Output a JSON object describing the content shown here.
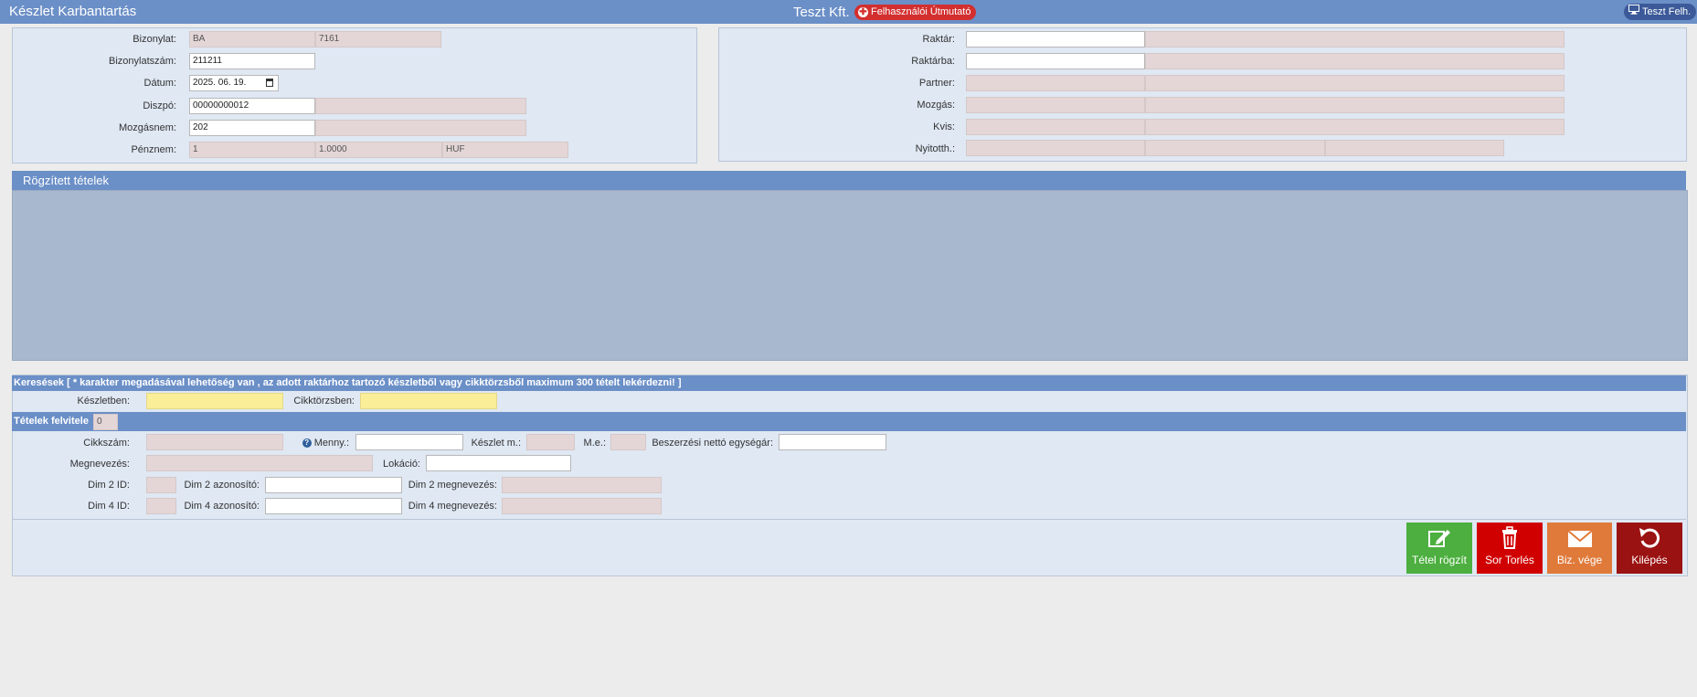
{
  "header": {
    "title": "Készlet Karbantartás",
    "company": "Teszt Kft.",
    "guide_label": "Felhasználói Útmutató",
    "user_label": "Teszt Felh."
  },
  "left_panel": {
    "bizonylat": {
      "label": "Bizonylat:",
      "value1": "BA",
      "value2": "7161"
    },
    "bizonylatszam": {
      "label": "Bizonylatszám:",
      "value": "211211"
    },
    "datum": {
      "label": "Dátum:",
      "value": "2025. 06. 19."
    },
    "diszpo": {
      "label": "Diszpó:",
      "value": "00000000012",
      "value2": ""
    },
    "mozgasnem": {
      "label": "Mozgásnem:",
      "value": "202",
      "value2": ""
    },
    "penznem": {
      "label": "Pénznem:",
      "value1": "1",
      "value2": "1.0000",
      "value3": "HUF"
    }
  },
  "right_panel": {
    "raktar": {
      "label": "Raktár:",
      "value": "",
      "desc": ""
    },
    "raktarba": {
      "label": "Raktárba:",
      "value": "",
      "desc": ""
    },
    "partner": {
      "label": "Partner:",
      "value": "",
      "desc": ""
    },
    "mozgas": {
      "label": "Mozgás:",
      "value": "",
      "desc": ""
    },
    "kvis": {
      "label": "Kvis:",
      "value": "",
      "desc": ""
    },
    "nyitotth": {
      "label": "Nyitotth.:",
      "value1": "",
      "value2": "",
      "value3": ""
    }
  },
  "recorded_items": {
    "title": "Rögzített tételek"
  },
  "searches": {
    "title": "Keresések [ * karakter megadásával lehetőség van , az adott raktárhoz tartozó készletből vagy cikktörzsből maximum 300 tételt lekérdezni! ]",
    "keszletben_label": "Készletben:",
    "keszletben_value": "",
    "cikktorzsben_label": "Cikktörzsben:",
    "cikktorzsben_value": ""
  },
  "item_entry": {
    "title": "Tételek felvitele",
    "count": "0",
    "cikkszam_label": "Cikkszám:",
    "menny_label": "Menny.:",
    "keszlet_label": "Készlet m.:",
    "me_label": "M.e.:",
    "beszerzesi_label": "Beszerzési nettó egységár:",
    "megnevezes_label": "Megnevezés:",
    "lokacio_label": "Lokáció:",
    "dim2id_label": "Dim 2 ID:",
    "dim2azon_label": "Dim 2 azonosító:",
    "dim2megn_label": "Dim 2 megnevezés:",
    "dim4id_label": "Dim 4 ID:",
    "dim4azon_label": "Dim 4 azonosító:",
    "dim4megn_label": "Dim 4 megnevezés:"
  },
  "actions": {
    "tetel_rogzit": "Tétel rögzít",
    "sor_torles": "Sor Torlés",
    "biz_vege": "Biz. vége",
    "kilepes": "Kilépés",
    "colors": {
      "green": "#4caf3f",
      "red": "#d10000",
      "orange": "#e07a3a",
      "darkred": "#9b1212"
    }
  },
  "icons": [
    "monitor-icon",
    "plus-circle-icon",
    "question-icon",
    "edit-icon",
    "trash-icon",
    "envelope-icon",
    "undo-icon",
    "calendar-icon"
  ]
}
